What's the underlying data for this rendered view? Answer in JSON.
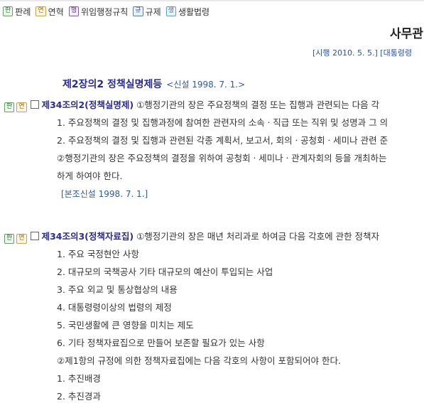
{
  "legend": [
    {
      "tag": "판",
      "label": "판례",
      "cls": "t-pan"
    },
    {
      "tag": "연",
      "label": "연혁",
      "cls": "t-yeon"
    },
    {
      "tag": "행",
      "label": "위임행정규칙",
      "cls": "t-haeng"
    },
    {
      "tag": "규",
      "label": "규제",
      "cls": "t-gyu"
    },
    {
      "tag": "생",
      "label": "생활법령",
      "cls": "t-saeng"
    }
  ],
  "law": {
    "title": "사무관",
    "meta": "[시행 2010. 5. 5.] [대통령령"
  },
  "chapter": {
    "title": "제2장의2 정책실명제등",
    "note": "<신설 1998. 7. 1.>"
  },
  "articles": [
    {
      "tags": [
        "판",
        "연"
      ],
      "number": "제34조의2(정책실명제)",
      "body": " ①행정기관의 장은 주요정책의 결정 또는 집행과 관련되는 다음 각",
      "lines": [
        "1. 주요정책의 결정 및 집행과정에 참여한 관련자의 소속ㆍ직급 또는 직위 및 성명과 그 의",
        "2. 주요정책의 결정 및 집행과 관련된 각종 계획서, 보고서, 회의ㆍ공청회ㆍ세미나 관련 준",
        "②행정기관의 장은 주요정책의 결정을 위하여 공청회ㆍ세미나ㆍ관계자회의 등을 개최하는",
        "하게 하여야 한다."
      ],
      "amend": "[본조신설 1998. 7. 1.]"
    },
    {
      "tags": [
        "판",
        "연"
      ],
      "number": "제34조의3(정책자료집)",
      "body": " ①행정기관의 장은 매년 처리과로 하여금 다음 각호에 관한 정책자",
      "lines": [
        "1. 주요 국정현안 사항",
        "2. 대규모의 국책공사 기타 대규모의 예산이 투입되는 사업",
        "3. 주요 외교 및 통상협상의 내용",
        "4. 대통령령이상의 법령의 제정",
        "5. 국민생활에 큰 영향을 미치는 제도",
        "6. 기타 정책자료집으로 만들어 보존할 필요가 있는 사항",
        "②제1항의 규정에 의한 정책자료집에는 다음 각호의 사항이 포함되어야 한다.",
        "1. 추진배경",
        "2. 추진경과"
      ]
    }
  ]
}
